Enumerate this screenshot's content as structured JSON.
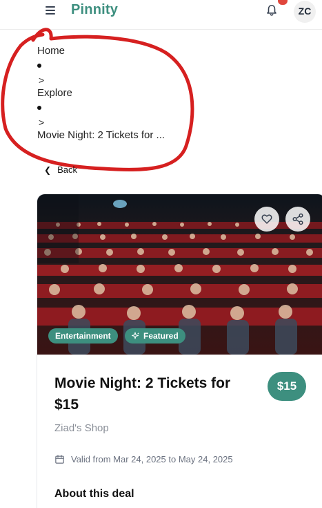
{
  "header": {
    "brand": "Pinnity",
    "avatar_initials": "ZC",
    "menu_icon": "hamburger-icon",
    "notification_icon": "bell-icon"
  },
  "breadcrumb": {
    "items": [
      "Home",
      "Explore",
      "Movie Night: 2 Tickets for ..."
    ],
    "separator": ">"
  },
  "back": {
    "label": "Back"
  },
  "deal": {
    "tags": [
      "Entertainment",
      "Featured"
    ],
    "title": "Movie Night: 2 Tickets for $15",
    "price": "$15",
    "shop": "Ziad's Shop",
    "validity": "Valid from Mar 24, 2025 to May 24, 2025",
    "about_heading": "About this deal"
  },
  "colors": {
    "brand": "#3d8f7f",
    "badge": "#e0463c",
    "annotation": "#d62020"
  }
}
